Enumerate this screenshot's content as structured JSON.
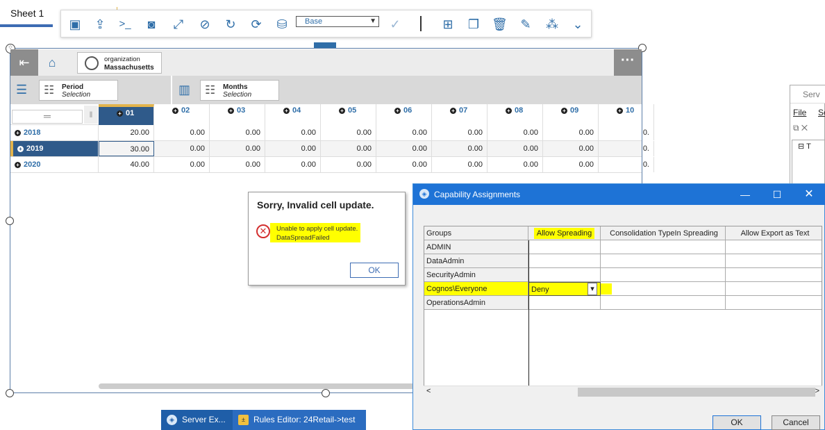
{
  "sheet_tab": "Sheet 1",
  "toolbar": {
    "icons": [
      "select-icon",
      "export-icon",
      "terminal-icon",
      "snapshot-icon",
      "expand-icon",
      "hide-icon",
      "refresh-icon",
      "sync-icon",
      "sandbox-icon"
    ],
    "sandbox_select": "Base",
    "right_icons": [
      "insert-icon",
      "copy-icon",
      "delete-icon",
      "edit-icon",
      "chart-icon",
      "more-icon"
    ]
  },
  "context": {
    "title": "organization",
    "value": "Massachusetts"
  },
  "row_dimension": {
    "name": "Period",
    "subtitle": "Selection"
  },
  "col_dimension": {
    "name": "Months",
    "subtitle": "Selection"
  },
  "columns": [
    "01",
    "02",
    "03",
    "04",
    "05",
    "06",
    "07",
    "08",
    "09",
    "10"
  ],
  "rows": [
    {
      "label": "2018",
      "values": [
        "20.00",
        "0.00",
        "0.00",
        "0.00",
        "0.00",
        "0.00",
        "0.00",
        "0.00",
        "0.00",
        "0."
      ]
    },
    {
      "label": "2019",
      "values": [
        "30.00",
        "0.00",
        "0.00",
        "0.00",
        "0.00",
        "0.00",
        "0.00",
        "0.00",
        "0.00",
        "0."
      ]
    },
    {
      "label": "2020",
      "values": [
        "40.00",
        "0.00",
        "0.00",
        "0.00",
        "0.00",
        "0.00",
        "0.00",
        "0.00",
        "0.00",
        "0."
      ]
    }
  ],
  "error_dialog": {
    "title": "Sorry, Invalid cell update.",
    "line1": "Unable to apply cell update.",
    "line2": "DataSpreadFailed",
    "ok": "OK"
  },
  "bg_window": {
    "title": "Serv",
    "menu1": "File",
    "menu2": "Se",
    "tree": "T"
  },
  "capability": {
    "title": "Capability Assignments",
    "headers": [
      "Groups",
      "Allow Spreading",
      "Consolidation TypeIn Spreading",
      "Allow Export as Text"
    ],
    "groups": [
      "ADMIN",
      "DataAdmin",
      "SecurityAdmin",
      "Cognos\\Everyone",
      "OperationsAdmin"
    ],
    "selected_value": "Deny",
    "ok": "OK",
    "cancel": "Cancel"
  },
  "taskbar": [
    {
      "label": "Server Ex..."
    },
    {
      "label": "Rules Editor:  24Retail->test"
    }
  ],
  "colors": {
    "accent": "#2f6ea8",
    "highlight": "#ffff00",
    "titlebar": "#1e73d6"
  }
}
